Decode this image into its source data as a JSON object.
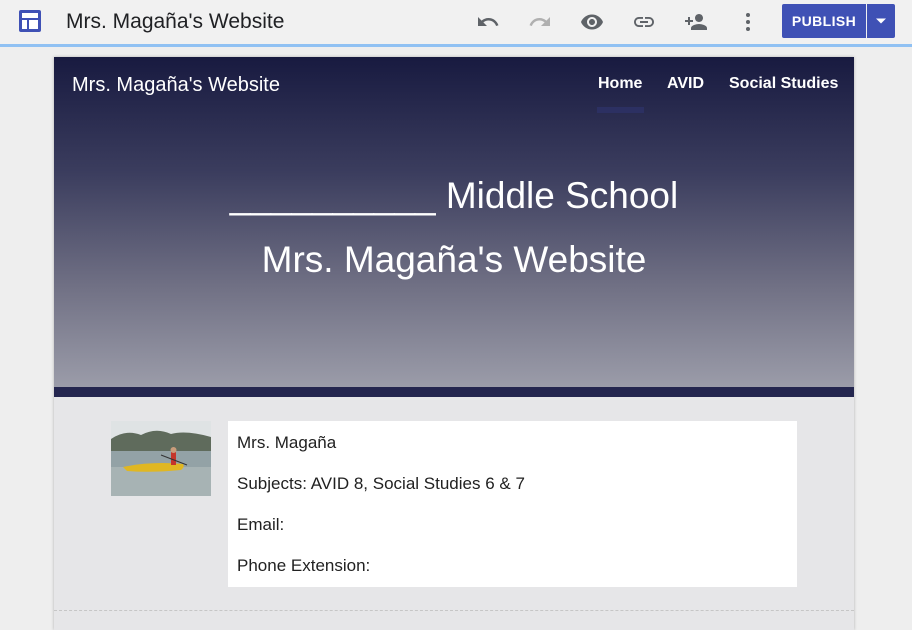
{
  "toolbar": {
    "doc_title": "Mrs. Magaña's Website",
    "publish_label": "PUBLISH",
    "icons": [
      "layout-icon",
      "undo-icon",
      "redo-icon",
      "preview-icon",
      "link-icon",
      "share-icon",
      "more-icon",
      "dropdown-arrow-icon"
    ],
    "accent_color": "#3f51b5"
  },
  "site": {
    "title": "Mrs. Magaña's Website",
    "nav": [
      "Home",
      "AVID",
      "Social Studies"
    ],
    "active_nav": "Home"
  },
  "hero": {
    "line1": "__________ Middle School",
    "line2": "Mrs. Magaña's Website"
  },
  "info": {
    "name": "Mrs. Magaña",
    "subjects": "Subjects: AVID 8, Social Studies 6 & 7",
    "email": "Email:",
    "phone": "Phone Extension:"
  }
}
